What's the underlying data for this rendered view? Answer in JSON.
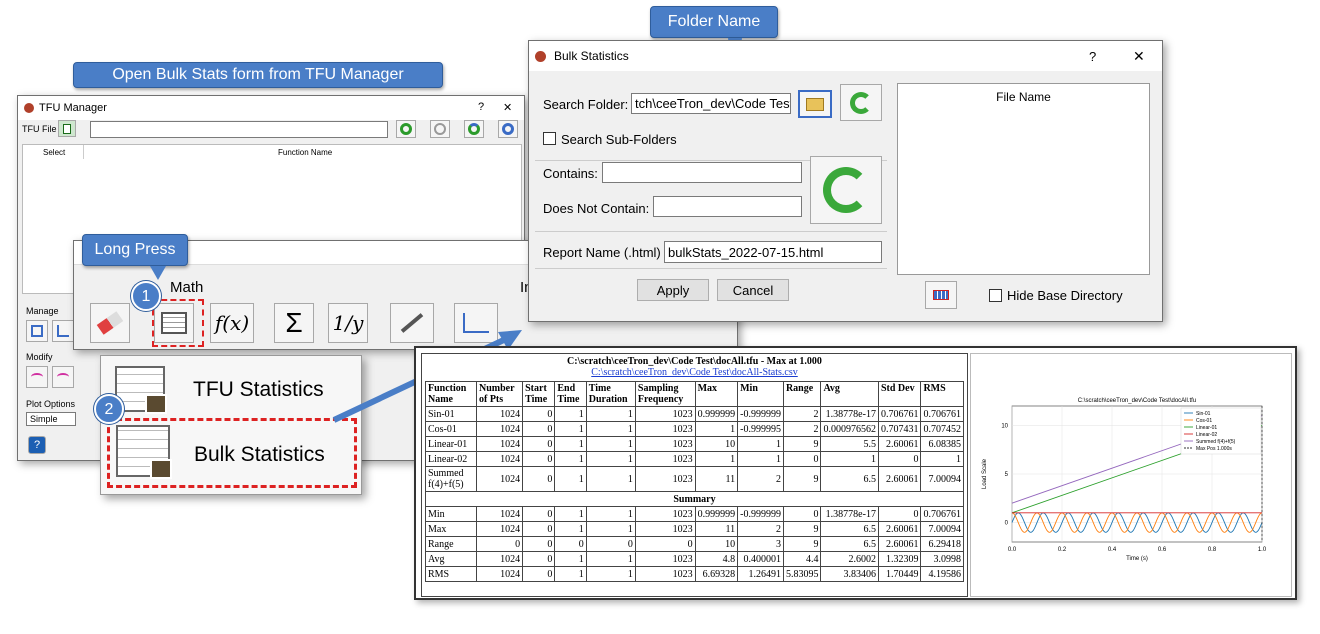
{
  "callouts": {
    "open_bulk": "Open Bulk Stats form from TFU Manager",
    "folder_name": "Folder Name",
    "long_press": "Long Press",
    "step1": "1",
    "step2": "2"
  },
  "tfu_manager": {
    "title": "TFU Manager",
    "help": "?",
    "close": "✕",
    "tfu_file_label": "TFU File",
    "col_select": "Select",
    "col_function_name": "Function Name",
    "manage": "Manage",
    "modify": "Modify",
    "plot_options": "Plot Options",
    "plot_value": "Simple"
  },
  "toolbar": {
    "math": "Math",
    "fx": "f(x)",
    "sigma": "Σ",
    "inv": "1/y",
    "in_partial": "In"
  },
  "menu": {
    "tfu_statistics": "TFU Statistics",
    "bulk_statistics": "Bulk Statistics"
  },
  "bulk_dialog": {
    "title": "Bulk Statistics",
    "help": "?",
    "close": "✕",
    "search_folder_label": "Search Folder:",
    "search_folder_value": "tch\\ceeTron_dev\\Code Test",
    "search_subfolders": "Search Sub-Folders",
    "contains_label": "Contains:",
    "not_contain_label": "Does Not Contain:",
    "report_label": "Report Name (.html)",
    "report_value": "bulkStats_2022-07-15.html",
    "apply": "Apply",
    "cancel": "Cancel",
    "file_name_header": "File Name",
    "hide_base": "Hide Base Directory"
  },
  "report": {
    "heading": "C:\\scratch\\ceeTron_dev\\Code Test\\docAll.tfu - Max at 1.000",
    "link": "C:\\scratch\\ceeTron_dev\\Code Test\\docAll-Stats.csv",
    "headers": [
      "Function Name",
      "Number of Pts",
      "Start Time",
      "End Time",
      "Time Duration",
      "Sampling Frequency",
      "Max",
      "Min",
      "Range",
      "Avg",
      "Std Dev",
      "RMS"
    ],
    "rows": [
      [
        "Sin-01",
        "1024",
        "0",
        "1",
        "1",
        "1023",
        "0.999999",
        "-0.999999",
        "2",
        "1.38778e-17",
        "0.706761",
        "0.706761"
      ],
      [
        "Cos-01",
        "1024",
        "0",
        "1",
        "1",
        "1023",
        "1",
        "-0.999995",
        "2",
        "0.000976562",
        "0.707431",
        "0.707452"
      ],
      [
        "Linear-01",
        "1024",
        "0",
        "1",
        "1",
        "1023",
        "10",
        "1",
        "9",
        "5.5",
        "2.60061",
        "6.08385"
      ],
      [
        "Linear-02",
        "1024",
        "0",
        "1",
        "1",
        "1023",
        "1",
        "1",
        "0",
        "1",
        "0",
        "1"
      ],
      [
        "Summed f(4)+f(5)",
        "1024",
        "0",
        "1",
        "1",
        "1023",
        "11",
        "2",
        "9",
        "6.5",
        "2.60061",
        "7.00094"
      ]
    ],
    "summary_label": "Summary",
    "summary_rows": [
      [
        "Min",
        "1024",
        "0",
        "1",
        "1",
        "1023",
        "0.999999",
        "-0.999999",
        "0",
        "1.38778e-17",
        "0",
        "0.706761"
      ],
      [
        "Max",
        "1024",
        "0",
        "1",
        "1",
        "1023",
        "11",
        "2",
        "9",
        "6.5",
        "2.60061",
        "7.00094"
      ],
      [
        "Range",
        "0",
        "0",
        "0",
        "0",
        "0",
        "10",
        "3",
        "9",
        "6.5",
        "2.60061",
        "6.29418"
      ],
      [
        "Avg",
        "1024",
        "0",
        "1",
        "1",
        "1023",
        "4.8",
        "0.400001",
        "4.4",
        "2.6002",
        "1.32309",
        "3.0998"
      ],
      [
        "RMS",
        "1024",
        "0",
        "1",
        "1",
        "1023",
        "6.69328",
        "1.26491",
        "5.83095",
        "3.83406",
        "1.70449",
        "4.19586"
      ]
    ]
  },
  "chart_data": {
    "type": "line",
    "title": "C:\\scratch\\ceeTron_dev\\Code Test\\docAll.tfu",
    "xlabel": "Time (s)",
    "ylabel": "Load Scale",
    "xlim": [
      0,
      1
    ],
    "ylim": [
      -2,
      12
    ],
    "xticks": [
      "0.0",
      "0.2",
      "0.4",
      "0.6",
      "0.8",
      "1.0"
    ],
    "yticks": [
      "0",
      "5",
      "10"
    ],
    "legend_position": "top-right",
    "series": [
      {
        "name": "Sin-01",
        "color": "#1f77b4",
        "kind": "sine",
        "amp": 1,
        "phase": 0
      },
      {
        "name": "Cos-01",
        "color": "#ff7f0e",
        "kind": "sine",
        "amp": 1,
        "phase": 1.5708
      },
      {
        "name": "Linear-01",
        "color": "#2ca02c",
        "kind": "line",
        "x": [
          0,
          1
        ],
        "y": [
          1,
          10
        ]
      },
      {
        "name": "Linear-02",
        "color": "#d62728",
        "kind": "line",
        "x": [
          0,
          1
        ],
        "y": [
          1,
          1
        ]
      },
      {
        "name": "Summed f(4)+f(5)",
        "color": "#9467bd",
        "kind": "line",
        "x": [
          0,
          1
        ],
        "y": [
          2,
          11
        ]
      },
      {
        "name": "Max Pos 1.000s",
        "color": "#333333",
        "kind": "vline",
        "x": 1
      }
    ]
  }
}
